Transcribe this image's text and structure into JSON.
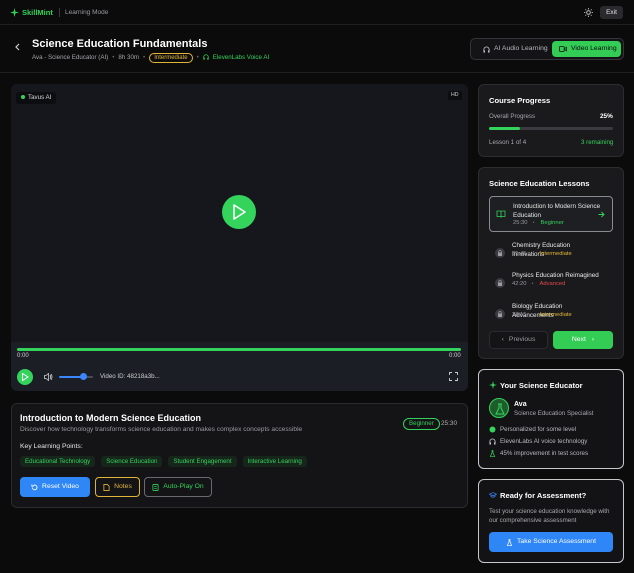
{
  "app": {
    "name": "SkillMint",
    "mode": "Learning Mode",
    "exit_label": "Exit"
  },
  "header": {
    "title": "Science Education Fundamentals",
    "instructor": "Ava - Science Educator (AI)",
    "duration": "8h 30m",
    "level": "Intermediate",
    "voice": "ElevenLabs Voice AI"
  },
  "mode_toggle": {
    "audio_label": "AI Audio Learning",
    "video_label": "Video Learning",
    "selected": "Video Learning"
  },
  "player": {
    "provider_badge": "Tavus AI",
    "quality_badge": "HD",
    "current_time": "0:00",
    "total_time": "0:00",
    "progress": 1.0,
    "volume": 0.7,
    "video_id": "Video ID: 48218a3b..."
  },
  "lesson": {
    "title": "Introduction to Modern Science Education",
    "description": "Discover how technology transforms science education and makes complex concepts accessible",
    "level": "Beginner",
    "duration": "25:30",
    "key_points_label": "Key Learning Points:",
    "tags": [
      "Educational Technology",
      "Science Education",
      "Student Engagement",
      "Interactive Learning"
    ],
    "reset_label": "Reset Video",
    "notes_label": "Notes",
    "autoplay_label": "Auto-Play On"
  },
  "progress": {
    "title": "Course Progress",
    "overall_label": "Overall Progress",
    "percent_text": "25%",
    "percent": 25,
    "lesson_count": "Lesson 1 of 4",
    "remaining": "3 remaining"
  },
  "lessons": {
    "title": "Science Education Lessons",
    "items": [
      {
        "title": "Introduction to Modern Science Education",
        "duration": "25:30",
        "level": "Beginner",
        "active": true,
        "icon": "book-icon"
      },
      {
        "title": "Chemistry Education Innovations",
        "duration": "35:45",
        "level": "Intermediate",
        "active": false,
        "icon": "lock-icon"
      },
      {
        "title": "Physics Education Reimagined",
        "duration": "42:20",
        "level": "Advanced",
        "active": false,
        "icon": "lock-icon"
      },
      {
        "title": "Biology Education Advancements",
        "duration": "38:15",
        "level": "Intermediate",
        "active": false,
        "icon": "lock-icon"
      }
    ],
    "prev_label": "Previous",
    "next_label": "Next"
  },
  "educator": {
    "title": "Your Science Educator",
    "name": "Ava",
    "role": "Science Education Specialist",
    "features": [
      "Personalized for some level",
      "ElevenLabs AI voice technology",
      "45% improvement in test scores"
    ]
  },
  "assessment": {
    "title": "Ready for Assessment?",
    "description": "Test your science education knowledge with our comprehensive assessment",
    "button_label": "Take Science Assessment"
  },
  "colors": {
    "accent_green": "#34d35c",
    "accent_blue": "#2f86f6",
    "warning_yellow": "#e0b53a",
    "danger_red": "#e04b4b",
    "background": "#0b0b0c"
  }
}
